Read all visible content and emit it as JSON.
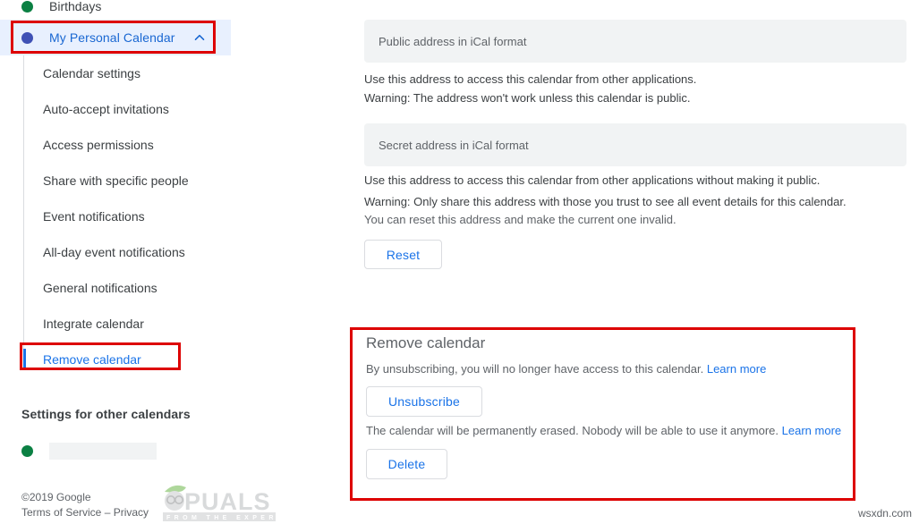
{
  "sidebar": {
    "top_calendar": {
      "label": "Birthdays",
      "dot_color": "#0b8043"
    },
    "selected_calendar": {
      "label": "My Personal Calendar",
      "dot_color": "#3f51b5",
      "expand_icon": "chevron-up-icon",
      "expanded": true
    },
    "submenu": [
      {
        "label": "Calendar settings",
        "active": false
      },
      {
        "label": "Auto-accept invitations",
        "active": false
      },
      {
        "label": "Access permissions",
        "active": false
      },
      {
        "label": "Share with specific people",
        "active": false
      },
      {
        "label": "Event notifications",
        "active": false
      },
      {
        "label": "All-day event notifications",
        "active": false
      },
      {
        "label": "General notifications",
        "active": false
      },
      {
        "label": "Integrate calendar",
        "active": false
      },
      {
        "label": "Remove calendar",
        "active": true
      }
    ],
    "other_calendars_title": "Settings for other calendars",
    "other_calendar": {
      "label": "",
      "dot_color": "#0b8043"
    },
    "footer": {
      "copyright": "©2019 Google",
      "terms": "Terms of Service",
      "separator": " – ",
      "privacy": "Privacy"
    },
    "watermark": {
      "name": "APPUALS",
      "tagline": "FROM THE EXPERTS!"
    }
  },
  "main": {
    "public_field": {
      "placeholder": "Public address in iCal format",
      "value": ""
    },
    "public_desc_1": "Use this address to access this calendar from other applications.",
    "public_desc_2": "Warning: The address won't work unless this calendar is public.",
    "secret_field": {
      "placeholder": "Secret address in iCal format",
      "value": ""
    },
    "secret_desc_1": "Use this address to access this calendar from other applications without making it public.",
    "secret_desc_2": "Warning: Only share this address with those you trust to see all event details for this calendar.",
    "secret_desc_3": "You can reset this address and make the current one invalid.",
    "reset_label": "Reset",
    "remove_panel": {
      "title": "Remove calendar",
      "unsubscribe_desc": "By unsubscribing, you will no longer have access to this calendar.",
      "unsubscribe_learn_more": "Learn more",
      "unsubscribe_label": "Unsubscribe",
      "delete_desc": "The calendar will be permanently erased. Nobody will be able to use it anymore.",
      "delete_learn_more": "Learn more",
      "delete_label": "Delete"
    }
  },
  "annotations": {
    "highlight_color": "#dd0000",
    "boxes": [
      "selected-calendar",
      "remove-calendar-menu-item",
      "remove-calendar-panel"
    ]
  },
  "source_watermark": "wsxdn.com",
  "colors": {
    "accent_blue": "#1a73e8",
    "selected_bg": "#e8f0fe",
    "field_bg": "#f1f3f4",
    "text": "#3c4043",
    "muted_text": "#5f6368"
  }
}
